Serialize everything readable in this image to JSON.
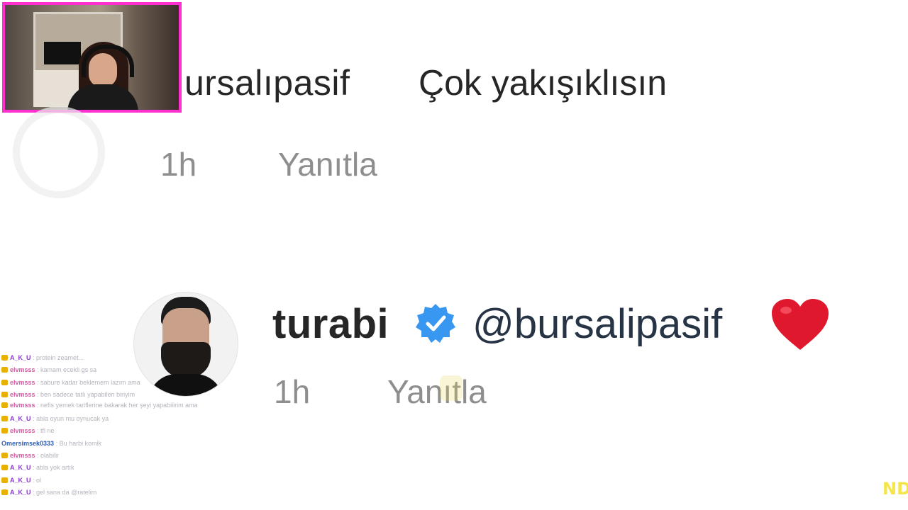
{
  "comment_1": {
    "username": "ursalıpasif",
    "text": "Çok yakışıklısın",
    "time": "1h",
    "reply_label": "Yanıtla"
  },
  "comment_2": {
    "username": "turabi",
    "mention": "@bursalipasif",
    "time": "1h",
    "reply_label": "Yanıtla",
    "verified_icon": "verified-badge-icon",
    "emoji_icon": "red-heart-icon"
  },
  "chat": {
    "messages": [
      {
        "user": "A_K_U",
        "text": ": protein zeamet...",
        "user_color": "purple"
      },
      {
        "user": "elvmsss",
        "text": ": kamam ecekli gs sa",
        "user_color": "pink"
      },
      {
        "user": "elvmsss",
        "text": ": sabure kadar beklemem lazım ama",
        "user_color": "pink"
      },
      {
        "user": "elvmsss",
        "text": ": ben sadece tatlı yapabilen biriyim",
        "user_color": "pink"
      },
      {
        "user": "elvmsss",
        "text": ": nefis yemek tariflerine bakarak her şeyi yapabilirim ama",
        "user_color": "pink"
      },
      {
        "user": "A_K_U",
        "text": ": abla oyun mu oynucak ya",
        "user_color": "purple"
      },
      {
        "user": "elvmsss",
        "text": ": tfl ne",
        "user_color": "pink"
      },
      {
        "user": "Omersimsek0333",
        "text": ": Bu harbi komik",
        "user_color": "blue"
      },
      {
        "user": "elvmsss",
        "text": ": olabilir",
        "user_color": "pink"
      },
      {
        "user": "A_K_U",
        "text": ": abla yok artık",
        "user_color": "purple"
      },
      {
        "user": "A_K_U",
        "text": ": ol",
        "user_color": "purple"
      },
      {
        "user": "A_K_U",
        "text": ": gel sana da @ratelim",
        "user_color": "purple"
      }
    ]
  },
  "watermark": "ND",
  "colors": {
    "webcam_border": "#ff2fd0",
    "verified_blue": "#3897f0",
    "heart_red": "#e0182d",
    "meta_gray": "#8e8e8e"
  }
}
